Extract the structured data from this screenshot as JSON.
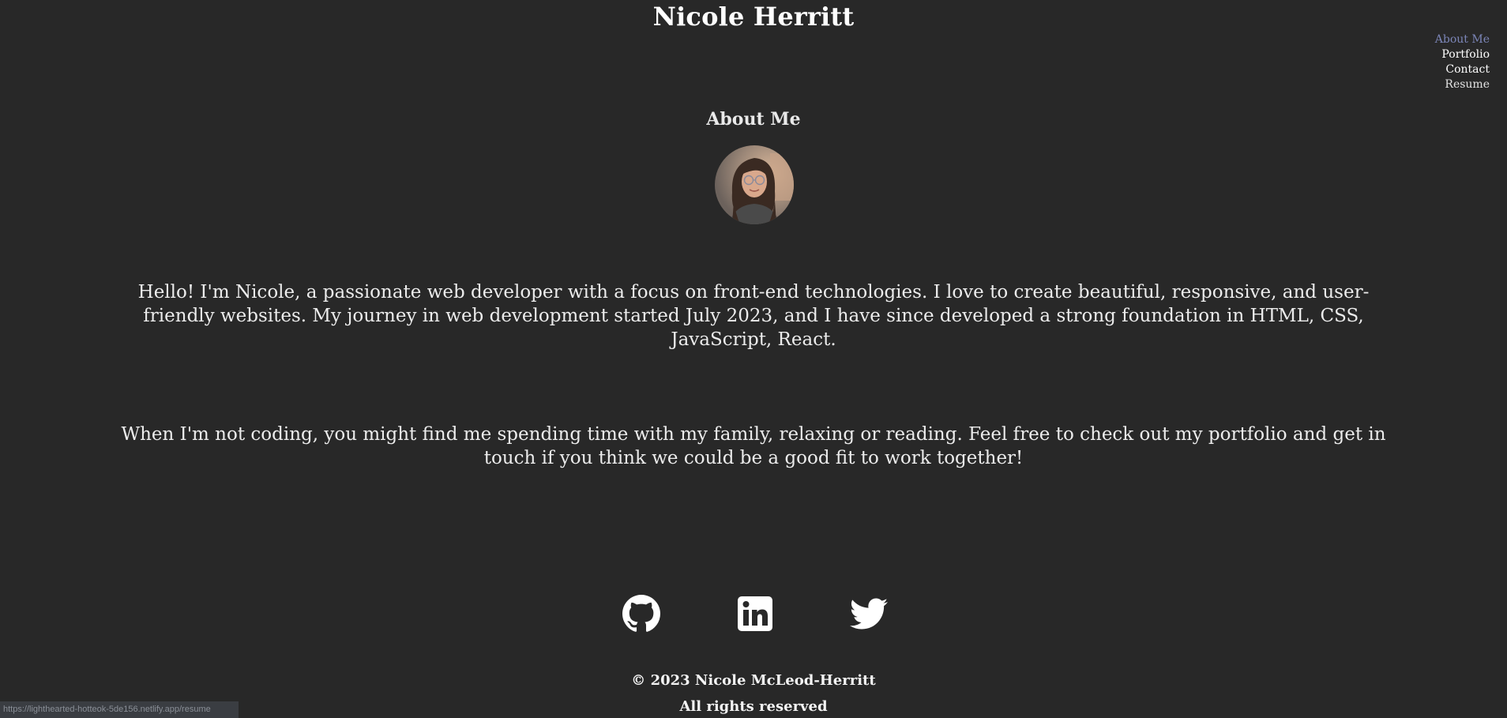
{
  "header": {
    "title": "Nicole Herritt"
  },
  "nav": {
    "items": [
      {
        "label": "About Me"
      },
      {
        "label": "Portfolio"
      },
      {
        "label": "Contact"
      },
      {
        "label": "Resume"
      }
    ],
    "active_color": "#7c86b8"
  },
  "about": {
    "heading": "About Me",
    "avatar_icon": "profile-photo",
    "paragraphs": [
      "Hello! I'm Nicole, a passionate web developer with a focus on front-end technologies. I love to create beautiful, responsive, and user-friendly websites. My journey in web development started July 2023, and I have since developed a strong foundation in HTML, CSS, JavaScript, React.",
      "When I'm not coding, you might find me spending time with my family, relaxing or reading. Feel free to check out my portfolio and get in touch if you think we could be a good fit to work together!"
    ]
  },
  "social": {
    "icons": [
      "github-icon",
      "linkedin-icon",
      "twitter-icon"
    ]
  },
  "footer": {
    "copyright": "© 2023 Nicole McLeod-Herritt",
    "rights": "All rights reserved"
  },
  "status_bar": {
    "url": "https://lighthearted-hotteok-5de156.netlify.app/resume"
  },
  "colors": {
    "background": "#282828",
    "text": "#ffffff"
  }
}
